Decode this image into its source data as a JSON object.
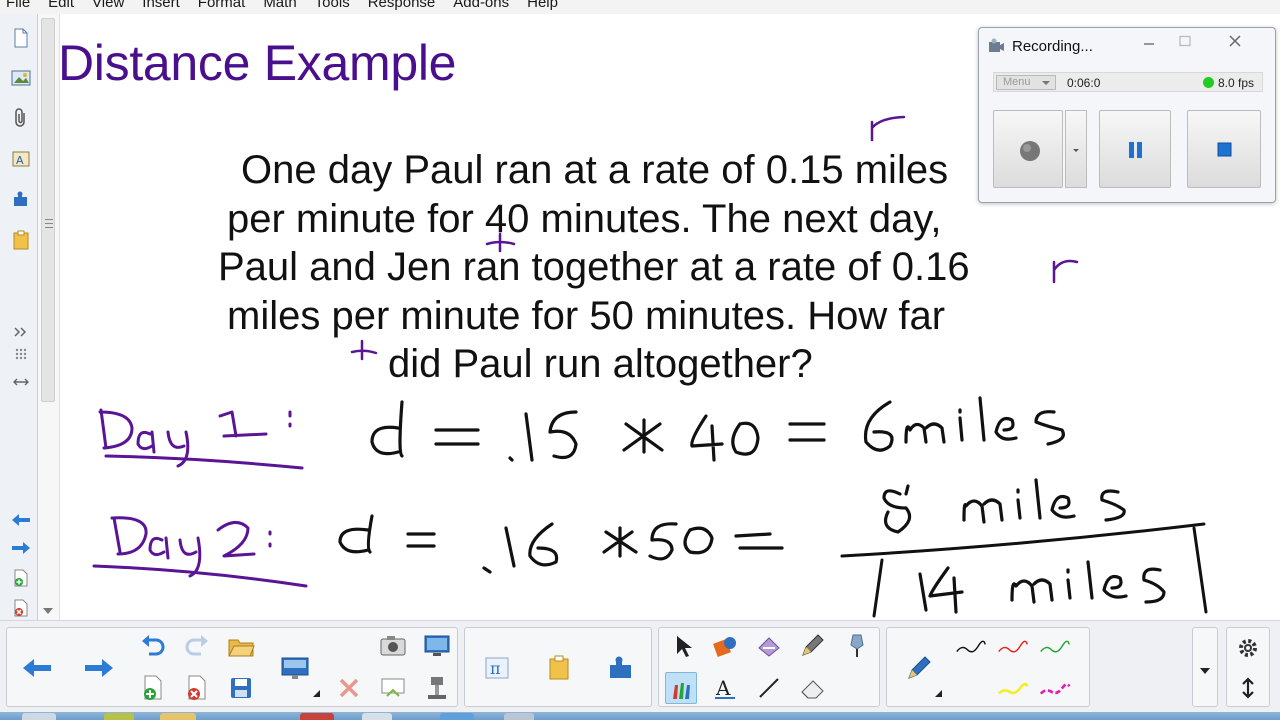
{
  "menu": [
    "File",
    "Edit",
    "View",
    "Insert",
    "Format",
    "Math",
    "Tools",
    "Response",
    "Add-ons",
    "Help"
  ],
  "board": {
    "title": "Distance Example",
    "problem_lines": [
      "One day Paul ran at a rate of 0.15 miles",
      "per minute for 40 minutes.  The next day,",
      "Paul and Jen ran together at a rate of 0.16",
      "miles per minute for 50 minutes.  How far",
      "did Paul run altogether?"
    ]
  },
  "recorder": {
    "title": "Recording...",
    "menu_label": "Menu",
    "time": "0:06:0",
    "fps": "8.0 fps"
  },
  "colors": {
    "title": "#4a0f8c",
    "ink_black": "#111111",
    "ink_purple": "#5a1496",
    "accent_blue": "#1e73d2",
    "fps_indicator": "#22cc22"
  },
  "icons": {
    "sidebar": [
      "page-sorter-icon",
      "gallery-icon",
      "attachments-icon",
      "properties-icon",
      "add-ons-icon",
      "lesson-activity-icon"
    ],
    "toolbar": [
      "previous-page-icon",
      "next-page-icon",
      "undo-icon",
      "redo-icon",
      "open-file-icon",
      "add-page-icon",
      "delete-page-icon",
      "save-icon",
      "screen-shade-icon",
      "delete-icon",
      "clear-page-icon",
      "document-camera-icon",
      "display-icon",
      "tool-icon",
      "math-icon",
      "lesson-activity-icon",
      "add-ons-icon",
      "select-icon",
      "fill-icon",
      "eraser-icon",
      "pen-icon",
      "magic-pen-icon",
      "creative-pens-icon",
      "text-icon",
      "line-icon",
      "eraser-tool-icon",
      "pen-black-icon",
      "pen-red-icon",
      "pen-green-icon",
      "highlighter-yellow-icon",
      "highlighter-magenta-icon",
      "settings-icon",
      "move-toolbar-icon"
    ]
  }
}
